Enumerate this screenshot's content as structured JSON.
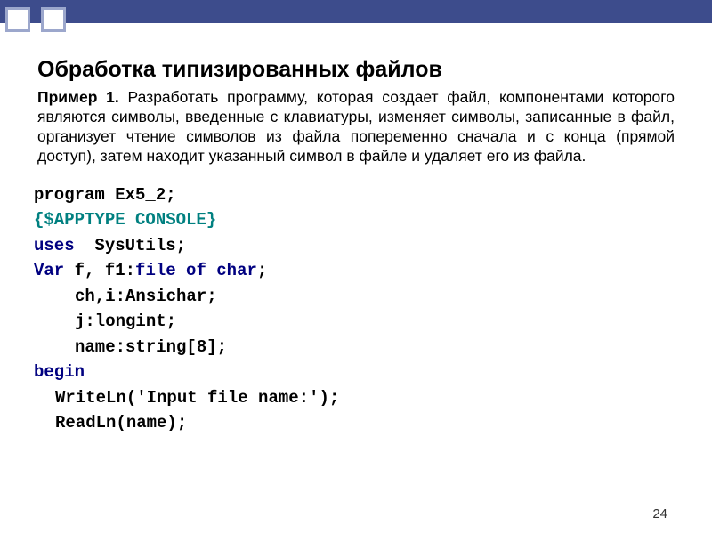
{
  "header": {
    "title": "Обработка типизированных файлов"
  },
  "example": {
    "label": "Пример 1.",
    "text": " Разработать программу, которая создает файл, компонентами которого являются символы, введенные с клавиатуры, изменяет символы, записанные в файл, организует чтение символов из файла попеременно сначала и с конца (прямой доступ), затем  находит указанный символ в файле и удаляет его из файла."
  },
  "code": {
    "l1": "program Ex5_2;",
    "l2": "{$APPTYPE CONSOLE}",
    "l3a": "uses",
    "l3b": "  SysUtils;",
    "l4a": "Var",
    "l4b": " f, f1:",
    "l4c": "file of char",
    "l4d": ";",
    "l5": "ch,i:Ansichar;",
    "l6": "j:longint;",
    "l7": "name:string[8];",
    "l8": "begin",
    "l9": "WriteLn('Input file name:');",
    "l10": "ReadLn(name);"
  },
  "page_number": "24"
}
